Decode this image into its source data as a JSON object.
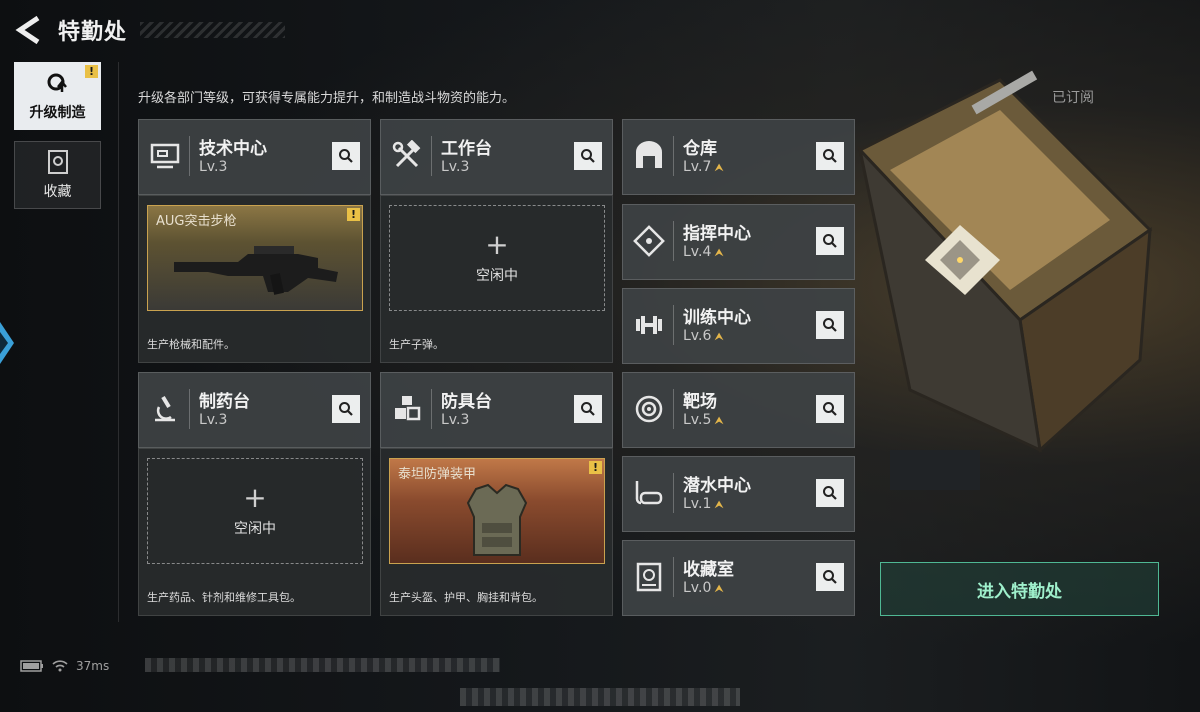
{
  "header": {
    "title": "特勤处"
  },
  "tabs": [
    {
      "label": "升级制造",
      "active": true,
      "alert": "!"
    },
    {
      "label": "收藏",
      "active": false
    }
  ],
  "description": "升级各部门等级，可获得专属能力提升，和制造战斗物资的能力。",
  "subscribed_label": "已订阅",
  "production": [
    {
      "name": "技术中心",
      "level": "Lv.3",
      "slot_item": "AUG突击步枪",
      "alert": "!",
      "caption": "生产枪械和配件。"
    },
    {
      "name": "工作台",
      "level": "Lv.3",
      "slot_idle": "空闲中",
      "caption": "生产子弹。"
    },
    {
      "name": "制药台",
      "level": "Lv.3",
      "slot_idle": "空闲中",
      "caption": "生产药品、针剂和维修工具包。"
    },
    {
      "name": "防具台",
      "level": "Lv.3",
      "slot_item": "泰坦防弹装甲",
      "alert": "!",
      "caption": "生产头盔、护甲、胸挂和背包。"
    }
  ],
  "facilities": [
    {
      "name": "仓库",
      "level": "Lv.7",
      "icon": "warehouse-icon"
    },
    {
      "name": "指挥中心",
      "level": "Lv.4",
      "icon": "command-center-icon"
    },
    {
      "name": "训练中心",
      "level": "Lv.6",
      "icon": "dumbbell-icon"
    },
    {
      "name": "靶场",
      "level": "Lv.5",
      "icon": "target-icon"
    },
    {
      "name": "潜水中心",
      "level": "Lv.1",
      "icon": "diving-goggles-icon"
    },
    {
      "name": "收藏室",
      "level": "Lv.0",
      "icon": "collection-room-icon"
    }
  ],
  "enter_button": "进入特勤处",
  "status": {
    "ping": "37ms"
  },
  "colors": {
    "accent_green": "#9ff0cc",
    "alert_yellow": "#e9c046",
    "upgrade_gold": "#e3b54a"
  }
}
